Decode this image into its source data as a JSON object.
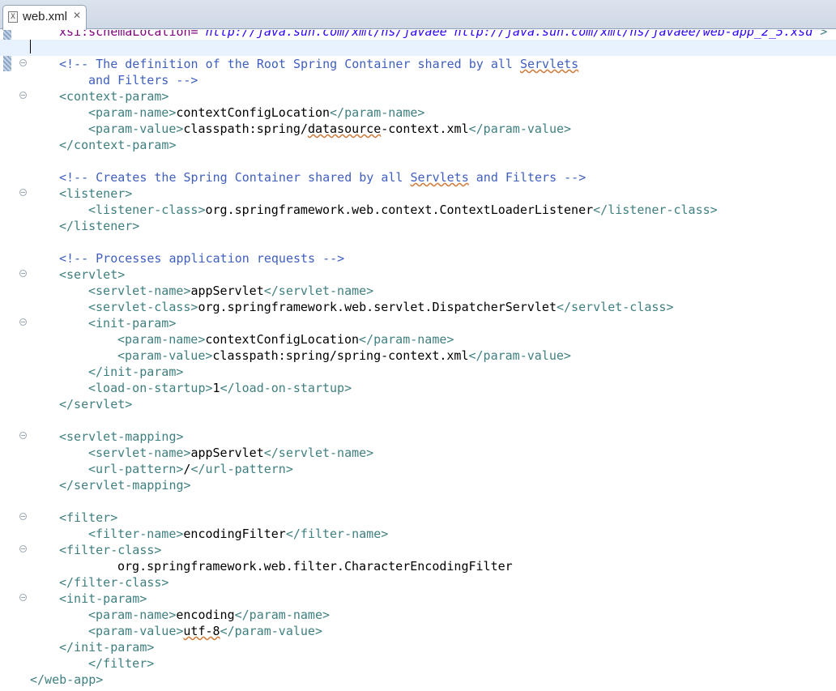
{
  "tab": {
    "label": "web.xml",
    "icon": "xml-file-icon",
    "icon_glyph": "X",
    "close_glyph": "✕"
  },
  "lines": [
    {
      "indent": 1,
      "parts": [
        [
          "a",
          "xsi:schemaLocation="
        ],
        [
          "s",
          "\"http://java.sun.com/xml/ns/javaee http://java.sun.com/xml/ns/javaee/web-app_2_5.xsd\""
        ],
        [
          "t",
          ">"
        ]
      ]
    },
    {
      "indent": 0,
      "current": true,
      "parts": []
    },
    {
      "indent": 1,
      "fold": true,
      "parts": [
        [
          "c",
          "<!-- The definition of the Root Spring Container shared by all "
        ],
        [
          "c",
          "Servlets",
          "sq"
        ]
      ]
    },
    {
      "indent": 2,
      "parts": [
        [
          "c",
          "and Filters -->"
        ]
      ]
    },
    {
      "indent": 1,
      "fold": true,
      "parts": [
        [
          "t",
          "<context-param>"
        ]
      ]
    },
    {
      "indent": 2,
      "parts": [
        [
          "t",
          "<param-name>"
        ],
        [
          "x",
          "contextConfigLocation"
        ],
        [
          "t",
          "</param-name>"
        ]
      ]
    },
    {
      "indent": 2,
      "parts": [
        [
          "t",
          "<param-value>"
        ],
        [
          "x",
          "classpath:spring/"
        ],
        [
          "x",
          "datasource",
          "sq"
        ],
        [
          "x",
          "-context.xml"
        ],
        [
          "t",
          "</param-value>"
        ]
      ]
    },
    {
      "indent": 1,
      "parts": [
        [
          "t",
          "</context-param>"
        ]
      ]
    },
    {
      "indent": 0,
      "parts": []
    },
    {
      "indent": 1,
      "parts": [
        [
          "c",
          "<!-- Creates the Spring Container shared by all "
        ],
        [
          "c",
          "Servlets",
          "sq"
        ],
        [
          "c",
          " and Filters -->"
        ]
      ]
    },
    {
      "indent": 1,
      "fold": true,
      "parts": [
        [
          "t",
          "<listener>"
        ]
      ]
    },
    {
      "indent": 2,
      "parts": [
        [
          "t",
          "<listener-class>"
        ],
        [
          "x",
          "org.springframework.web.context.ContextLoaderListener"
        ],
        [
          "t",
          "</listener-class>"
        ]
      ]
    },
    {
      "indent": 1,
      "parts": [
        [
          "t",
          "</listener>"
        ]
      ]
    },
    {
      "indent": 0,
      "parts": []
    },
    {
      "indent": 1,
      "parts": [
        [
          "c",
          "<!-- Processes application requests -->"
        ]
      ]
    },
    {
      "indent": 1,
      "fold": true,
      "parts": [
        [
          "t",
          "<servlet>"
        ]
      ]
    },
    {
      "indent": 2,
      "parts": [
        [
          "t",
          "<servlet-name>"
        ],
        [
          "x",
          "appServlet"
        ],
        [
          "t",
          "</servlet-name>"
        ]
      ]
    },
    {
      "indent": 2,
      "parts": [
        [
          "t",
          "<servlet-class>"
        ],
        [
          "x",
          "org.springframework.web.servlet.DispatcherServlet"
        ],
        [
          "t",
          "</servlet-class>"
        ]
      ]
    },
    {
      "indent": 2,
      "fold": true,
      "parts": [
        [
          "t",
          "<init-param>"
        ]
      ]
    },
    {
      "indent": 3,
      "parts": [
        [
          "t",
          "<param-name>"
        ],
        [
          "x",
          "contextConfigLocation"
        ],
        [
          "t",
          "</param-name>"
        ]
      ]
    },
    {
      "indent": 3,
      "parts": [
        [
          "t",
          "<param-value>"
        ],
        [
          "x",
          "classpath:spring/spring-context.xml"
        ],
        [
          "t",
          "</param-value>"
        ]
      ]
    },
    {
      "indent": 2,
      "parts": [
        [
          "t",
          "</init-param>"
        ]
      ]
    },
    {
      "indent": 2,
      "parts": [
        [
          "t",
          "<load-on-startup>"
        ],
        [
          "x",
          "1"
        ],
        [
          "t",
          "</load-on-startup>"
        ]
      ]
    },
    {
      "indent": 1,
      "parts": [
        [
          "t",
          "</servlet>"
        ]
      ]
    },
    {
      "indent": 0,
      "parts": []
    },
    {
      "indent": 1,
      "fold": true,
      "parts": [
        [
          "t",
          "<servlet-mapping>"
        ]
      ]
    },
    {
      "indent": 2,
      "parts": [
        [
          "t",
          "<servlet-name>"
        ],
        [
          "x",
          "appServlet"
        ],
        [
          "t",
          "</servlet-name>"
        ]
      ]
    },
    {
      "indent": 2,
      "parts": [
        [
          "t",
          "<url-pattern>"
        ],
        [
          "x",
          "/"
        ],
        [
          "t",
          "</url-pattern>"
        ]
      ]
    },
    {
      "indent": 1,
      "parts": [
        [
          "t",
          "</servlet-mapping>"
        ]
      ]
    },
    {
      "indent": 0,
      "parts": []
    },
    {
      "indent": 1,
      "fold": true,
      "parts": [
        [
          "t",
          "<filter>"
        ]
      ]
    },
    {
      "indent": 2,
      "parts": [
        [
          "t",
          "<filter-name>"
        ],
        [
          "x",
          "encodingFilter"
        ],
        [
          "t",
          "</filter-name>"
        ]
      ]
    },
    {
      "indent": 1,
      "fold": true,
      "parts": [
        [
          "t",
          "<filter-class>"
        ]
      ]
    },
    {
      "indent": 3,
      "parts": [
        [
          "x",
          "org.springframework.web.filter.CharacterEncodingFilter"
        ]
      ]
    },
    {
      "indent": 1,
      "parts": [
        [
          "t",
          "</filter-class>"
        ]
      ]
    },
    {
      "indent": 1,
      "fold": true,
      "parts": [
        [
          "t",
          "<init-param>"
        ]
      ]
    },
    {
      "indent": 2,
      "parts": [
        [
          "t",
          "<param-name>"
        ],
        [
          "x",
          "encoding"
        ],
        [
          "t",
          "</param-name>"
        ]
      ]
    },
    {
      "indent": 2,
      "parts": [
        [
          "t",
          "<param-value>"
        ],
        [
          "x",
          "utf-8",
          "sq"
        ],
        [
          "t",
          "</param-value>"
        ]
      ]
    },
    {
      "indent": 1,
      "parts": [
        [
          "t",
          "</init-param>"
        ]
      ]
    },
    {
      "indent": 2,
      "parts": [
        [
          "t",
          "</filter>"
        ]
      ]
    },
    {
      "indent": 0,
      "parts": [
        [
          "t",
          "</web-app>"
        ]
      ]
    }
  ]
}
